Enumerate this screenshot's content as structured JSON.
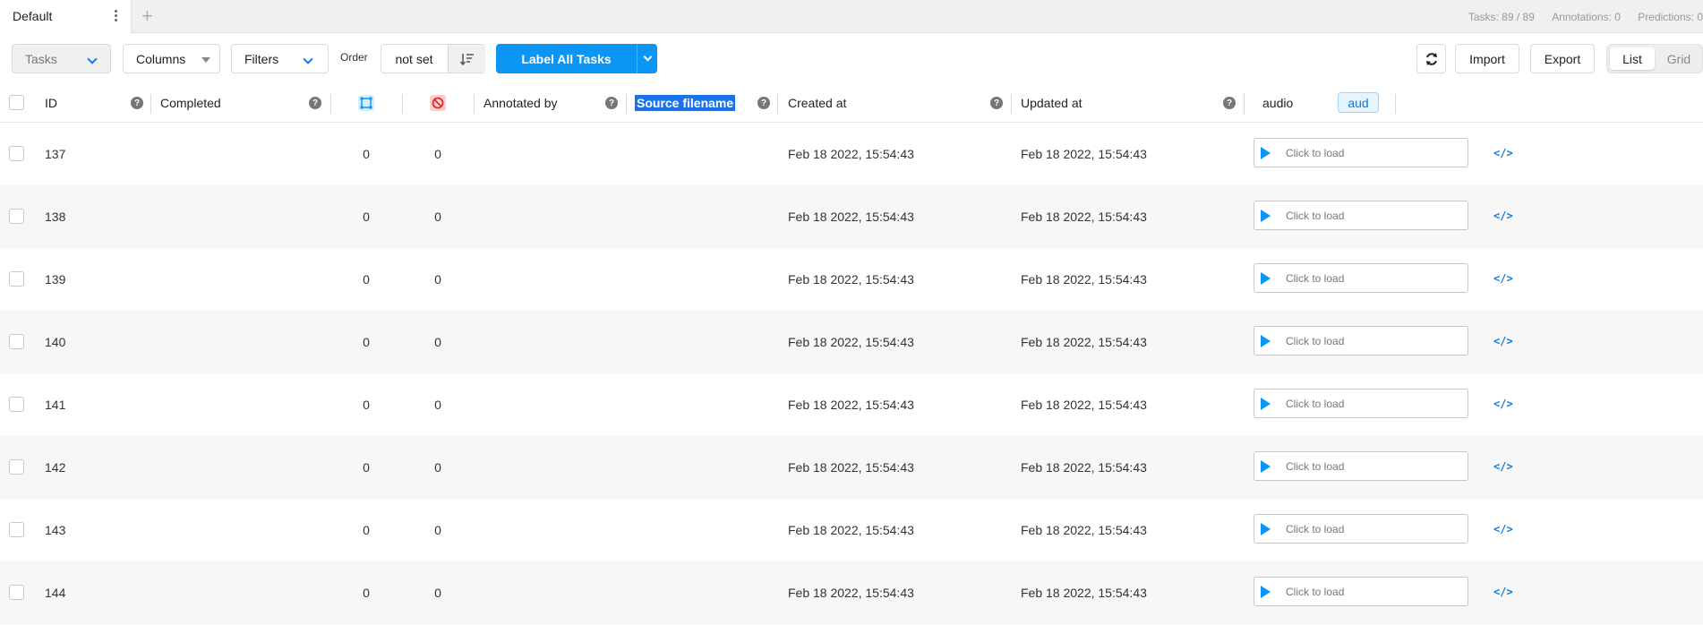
{
  "tabbar": {
    "tab_label": "Default",
    "add_tab_glyph": "+",
    "stats": {
      "tasks": "Tasks: 89 / 89",
      "annotations": "Annotations: 0",
      "predictions": "Predictions: 0"
    }
  },
  "toolbar": {
    "tasks_label": "Tasks",
    "columns_label": "Columns",
    "filters_label": "Filters",
    "order_label": "Order",
    "order_value": "not set",
    "label_all_label": "Label All Tasks",
    "import_label": "Import",
    "export_label": "Export",
    "view_list": "List",
    "view_grid": "Grid"
  },
  "table": {
    "headers": {
      "id": "ID",
      "completed": "Completed",
      "annotated_by": "Annotated by",
      "source_filename": "Source filename",
      "created_at": "Created at",
      "updated_at": "Updated at",
      "audio": "audio",
      "aud_badge": "aud"
    },
    "help_glyph": "?",
    "audio_placeholder": "Click to load",
    "code_glyph": "</>",
    "rows": [
      {
        "id": "137",
        "annotations": "0",
        "cancelled": "0",
        "created": "Feb 18 2022, 15:54:43",
        "updated": "Feb 18 2022, 15:54:43"
      },
      {
        "id": "138",
        "annotations": "0",
        "cancelled": "0",
        "created": "Feb 18 2022, 15:54:43",
        "updated": "Feb 18 2022, 15:54:43"
      },
      {
        "id": "139",
        "annotations": "0",
        "cancelled": "0",
        "created": "Feb 18 2022, 15:54:43",
        "updated": "Feb 18 2022, 15:54:43"
      },
      {
        "id": "140",
        "annotations": "0",
        "cancelled": "0",
        "created": "Feb 18 2022, 15:54:43",
        "updated": "Feb 18 2022, 15:54:43"
      },
      {
        "id": "141",
        "annotations": "0",
        "cancelled": "0",
        "created": "Feb 18 2022, 15:54:43",
        "updated": "Feb 18 2022, 15:54:43"
      },
      {
        "id": "142",
        "annotations": "0",
        "cancelled": "0",
        "created": "Feb 18 2022, 15:54:43",
        "updated": "Feb 18 2022, 15:54:43"
      },
      {
        "id": "143",
        "annotations": "0",
        "cancelled": "0",
        "created": "Feb 18 2022, 15:54:43",
        "updated": "Feb 18 2022, 15:54:43"
      },
      {
        "id": "144",
        "annotations": "0",
        "cancelled": "0",
        "created": "Feb 18 2022, 15:54:43",
        "updated": "Feb 18 2022, 15:54:43"
      }
    ]
  },
  "colors": {
    "accent": "#0b95f4",
    "link": "#0b7ad9",
    "selection": "#1a73e8"
  }
}
